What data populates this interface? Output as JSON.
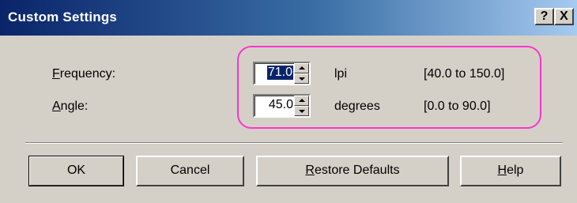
{
  "window": {
    "title": "Custom Settings",
    "help_glyph": "?",
    "close_glyph": "X"
  },
  "fields": {
    "frequency": {
      "mnemonic": "F",
      "label_rest": "requency:",
      "value": "71.0",
      "unit": "lpi",
      "range": "[40.0 to 150.0]"
    },
    "angle": {
      "mnemonic": "A",
      "label_rest": "ngle:",
      "value": "45.0",
      "unit": "degrees",
      "range": "[0.0 to 90.0]"
    }
  },
  "buttons": {
    "ok": "OK",
    "cancel": "Cancel",
    "restore_mnemonic": "R",
    "restore_rest": "estore Defaults",
    "help_mnemonic": "H",
    "help_rest": "elp"
  },
  "colors": {
    "title_bar_start": "#0a246a",
    "title_bar_end": "#a6caf0",
    "face": "#d4d0c8",
    "highlight": "#ff33cc",
    "selection": "#0a246a"
  }
}
